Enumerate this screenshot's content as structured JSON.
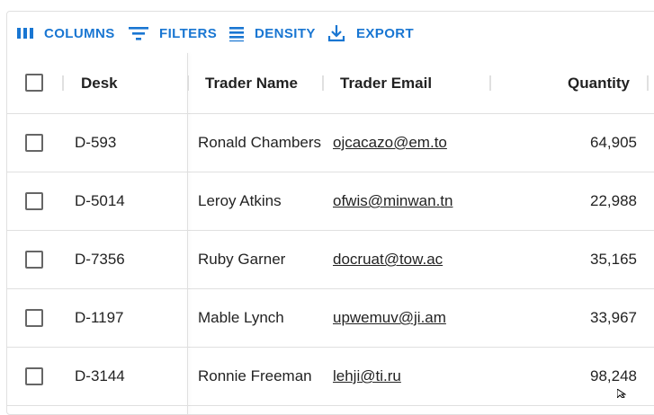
{
  "toolbar": {
    "columns_label": "COLUMNS",
    "filters_label": "FILTERS",
    "density_label": "DENSITY",
    "export_label": "EXPORT"
  },
  "columns": [
    "Desk",
    "Trader Name",
    "Trader Email",
    "Quantity"
  ],
  "rows": [
    {
      "desk": "D-593",
      "trader_name": "Ronald Chambers",
      "trader_email": "ojcacazo@em.to",
      "quantity": "64,905"
    },
    {
      "desk": "D-5014",
      "trader_name": "Leroy Atkins",
      "trader_email": "ofwis@minwan.tn",
      "quantity": "22,988"
    },
    {
      "desk": "D-7356",
      "trader_name": "Ruby Garner",
      "trader_email": "docruat@tow.ac",
      "quantity": "35,165"
    },
    {
      "desk": "D-1197",
      "trader_name": "Mable Lynch",
      "trader_email": "upwemuv@ji.am",
      "quantity": "33,967"
    },
    {
      "desk": "D-3144",
      "trader_name": "Ronnie Freeman",
      "trader_email": "lehji@ti.ru",
      "quantity": "98,248"
    }
  ],
  "colors": {
    "accent": "#1976d2",
    "border": "#e0e0e0"
  },
  "icons": [
    "columns-icon",
    "filter-icon",
    "density-icon",
    "export-icon",
    "mouse-cursor-icon"
  ]
}
